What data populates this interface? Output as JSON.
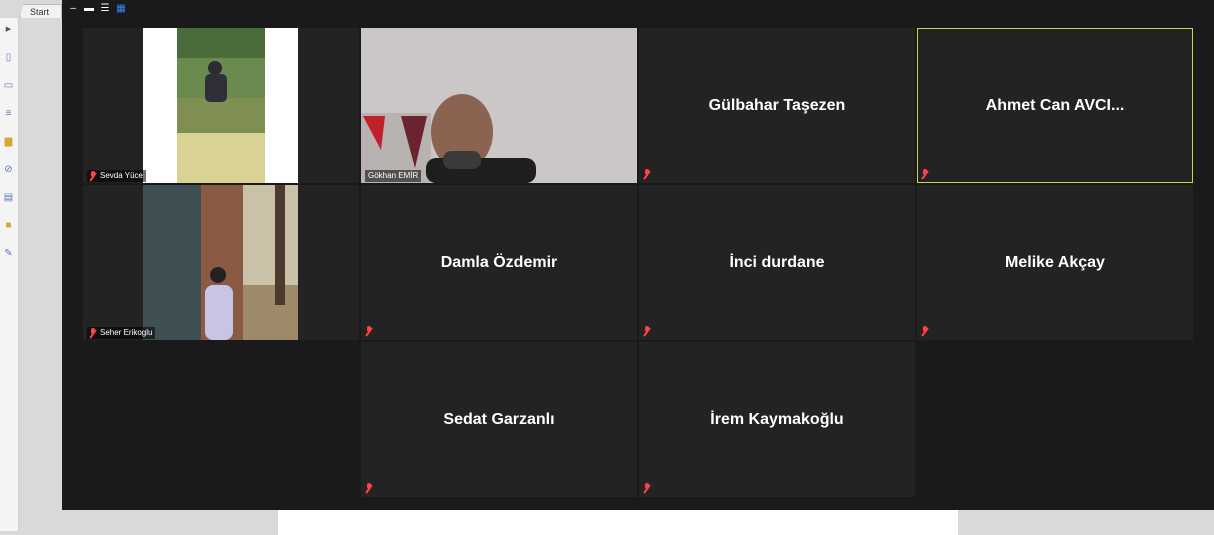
{
  "editor": {
    "tab_label": "Start"
  },
  "view_controls": [
    "minimize-icon",
    "speaker-view-icon",
    "gallery-rows-icon",
    "gallery-grid-icon"
  ],
  "participants": [
    {
      "name": "Sevda Yüce",
      "video": true
    },
    {
      "name": "Gökhan EMİR",
      "video": true
    },
    {
      "name": "Gülbahar Taşezen",
      "video": false
    },
    {
      "name": "Ahmet Can AVCI...",
      "video": false,
      "active_speaker": true
    },
    {
      "name": "Seher Erikoglu",
      "video": true
    },
    {
      "name": "Damla Özdemir",
      "video": false
    },
    {
      "name": "İnci durdane",
      "video": false
    },
    {
      "name": "Melike Akçay",
      "video": false
    },
    {
      "name": "Sedat Garzanlı",
      "video": false
    },
    {
      "name": "İrem Kaymakoğlu",
      "video": false
    }
  ],
  "colors": {
    "mute": "#ff4343",
    "active_speaker_border": "#c6d85a",
    "tile_bg": "#232323",
    "window_bg": "#1a1a1a"
  }
}
